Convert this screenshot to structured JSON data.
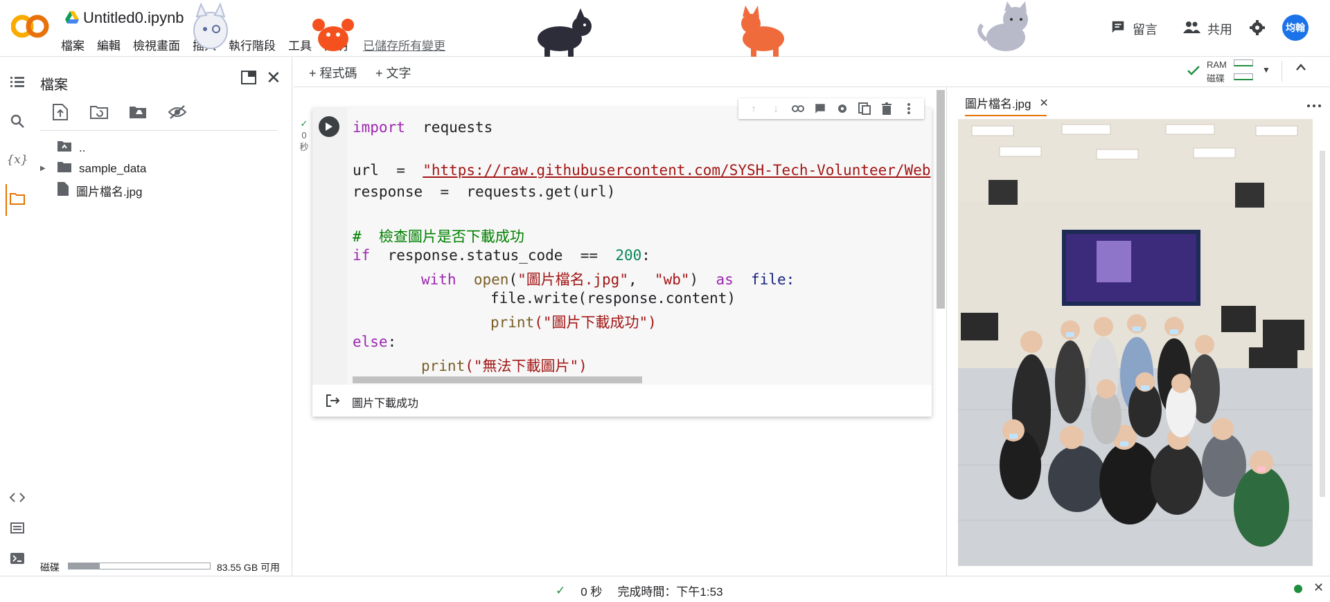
{
  "header": {
    "notebook_title": "Untitled0.ipynb",
    "menu": [
      "檔案",
      "編輯",
      "檢視畫面",
      "插入",
      "執行階段",
      "工具",
      "說明"
    ],
    "saved_status": "已儲存所有變更",
    "comment_label": "留言",
    "share_label": "共用",
    "avatar_text": "均翰",
    "colors": {
      "logo_orange": "#f9ab00",
      "avatar_bg": "#1a73e8"
    }
  },
  "files_panel": {
    "title": "檔案",
    "tree": [
      {
        "name": "..",
        "kind": "parent-folder"
      },
      {
        "name": "sample_data",
        "kind": "folder"
      },
      {
        "name": "圖片檔名.jpg",
        "kind": "file"
      }
    ],
    "disk_label": "磁碟",
    "disk_free": "83.55 GB 可用",
    "disk_usage_fraction": 0.22
  },
  "toolbar": {
    "add_code": "+ 程式碼",
    "add_text": "+ 文字",
    "ram_label": "RAM",
    "disk_label": "磁碟"
  },
  "cell": {
    "exec_check": "✓",
    "exec_time_value": "0",
    "exec_time_unit": "秒",
    "code": {
      "l1_kw": "import",
      "l1_rest": "requests",
      "l3_var": "url",
      "l3_eq": "=",
      "l3_str": "\"https://raw.githubusercontent.com/SYSH-Tech-Volunteer/Web",
      "l4_var": "response",
      "l4_eq": "=",
      "l4_call": "requests.get(url)",
      "l6_comment": "#  檢查圖片是否下載成功",
      "l7_kw": "if",
      "l7_rest": "response.status_code",
      "l7_op": "==",
      "l7_num": "200",
      "l7_colon": ":",
      "l8_kw": "with",
      "l8_fn": "open",
      "l8_args_open": "(",
      "l8_str1": "\"圖片檔名.jpg\"",
      "l8_comma": ",",
      "l8_str2": "\"wb\"",
      "l8_args_close": ")",
      "l8_as": "as",
      "l8_file": "file:",
      "l9": "file.write(response.content)",
      "l10_fn": "print",
      "l10_str": "(\"圖片下載成功\")",
      "l11_kw": "else",
      "l11_colon": ":",
      "l12_fn": "print",
      "l12_str": "(\"無法下載圖片\")"
    },
    "output": "圖片下載成功"
  },
  "viewer": {
    "tab_label": "圖片檔名.jpg"
  },
  "status": {
    "check": "✓",
    "elapsed": "0 秒",
    "completed": "完成時間：下午1:53"
  }
}
